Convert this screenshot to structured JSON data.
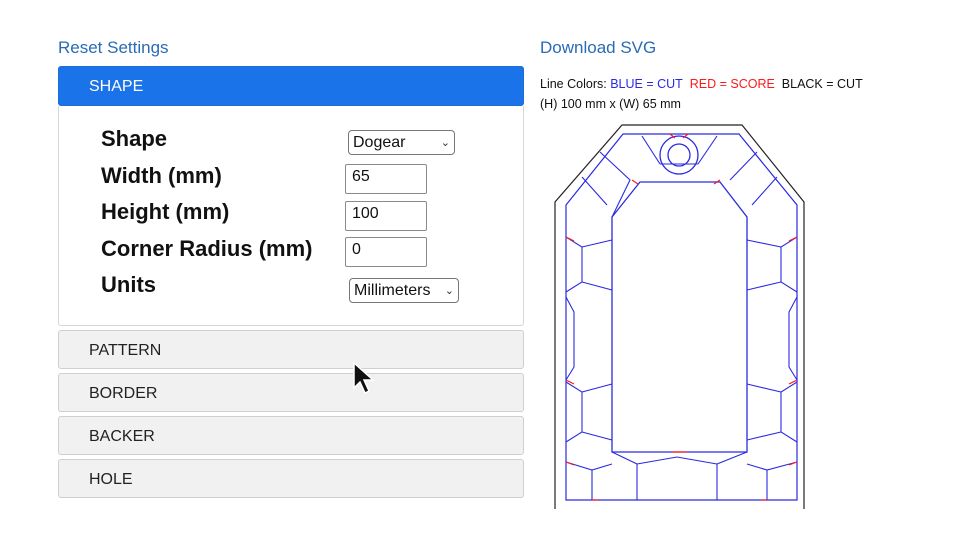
{
  "links": {
    "reset": "Reset Settings",
    "download": "Download SVG"
  },
  "accordion": {
    "shape_header": "SHAPE",
    "sections": [
      "PATTERN",
      "BORDER",
      "BACKER",
      "HOLE"
    ]
  },
  "form": {
    "shape_label": "Shape",
    "shape_value": "Dogear",
    "width_label": "Width (mm)",
    "width_value": "65",
    "height_label": "Height (mm)",
    "height_value": "100",
    "corner_label": "Corner Radius (mm)",
    "corner_value": "0",
    "units_label": "Units",
    "units_value": "Millimeters"
  },
  "legend": {
    "prefix": "Line Colors:",
    "blue": "BLUE = CUT",
    "red": "RED = SCORE",
    "black": "BLACK = CUT",
    "dimensions": "(H) 100 mm x (W) 65 mm"
  },
  "colors": {
    "accent": "#1a73e8",
    "link": "#2a6bb5",
    "cut_blue": "#2a2ae0",
    "score_red": "#ff1a1a",
    "outline_black": "#222222"
  },
  "icons": {
    "cursor": "arrow-cursor-icon",
    "select": "chevron-down-icon"
  }
}
